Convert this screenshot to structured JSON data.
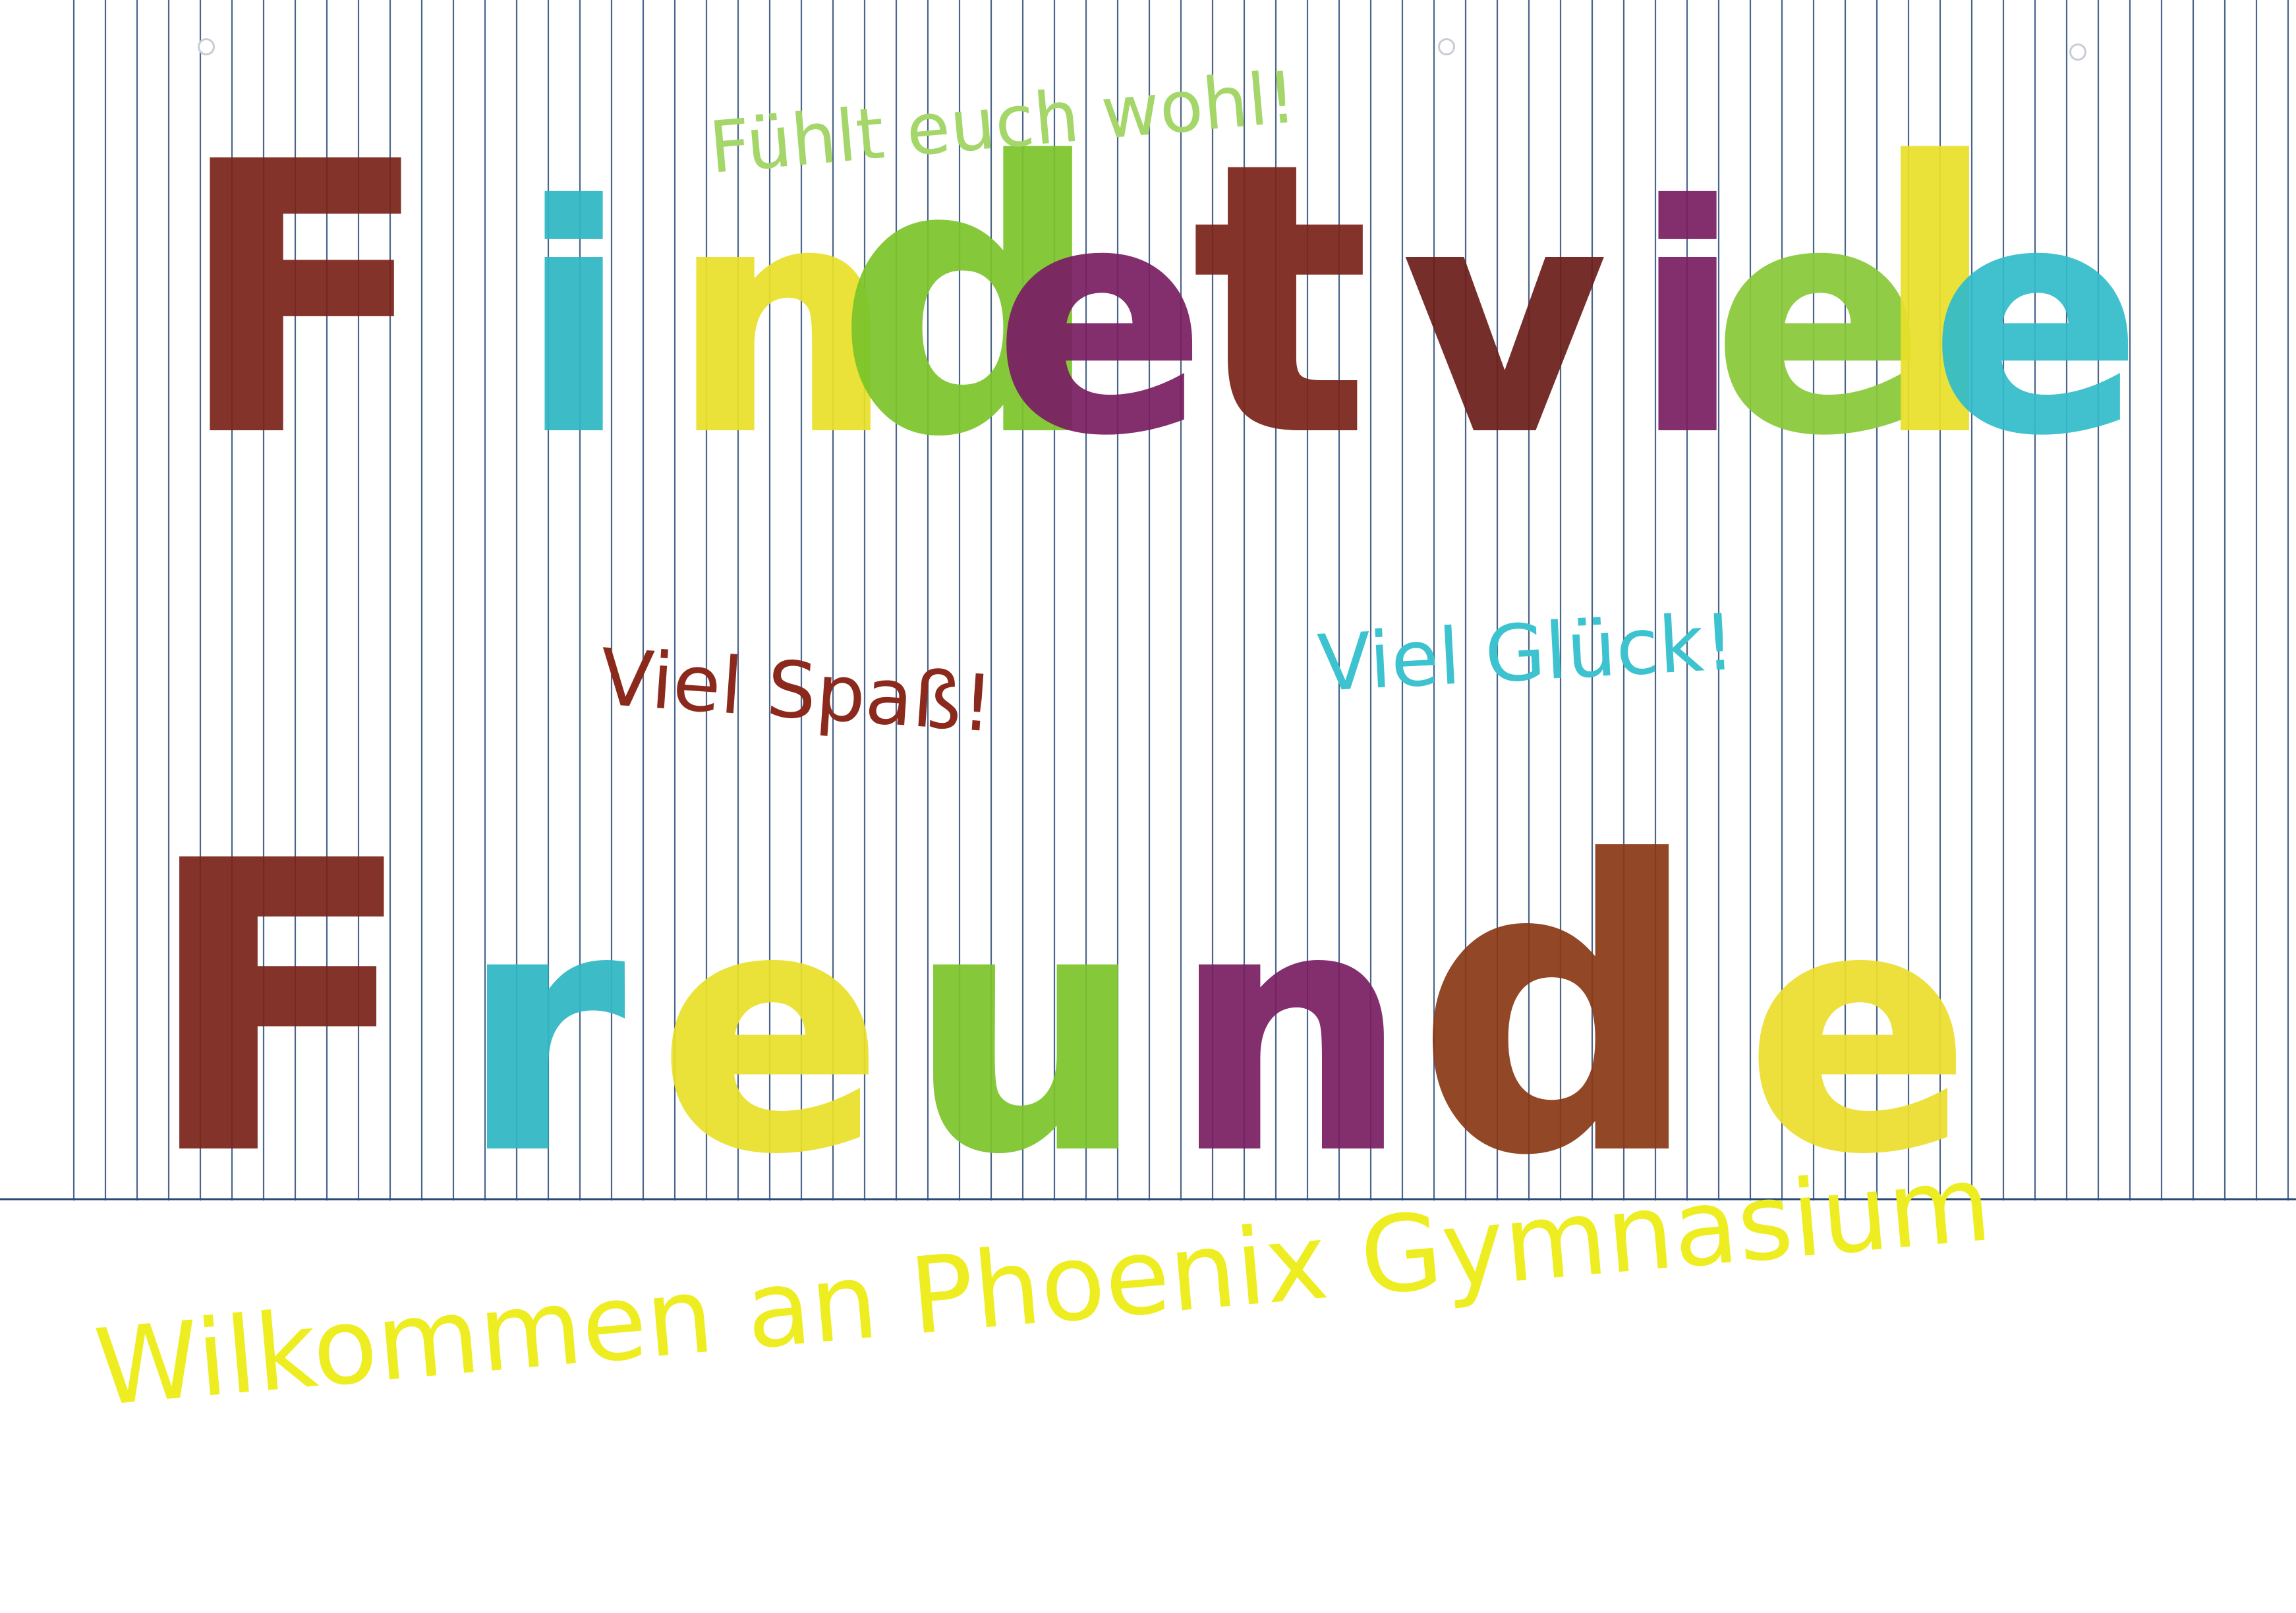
{
  "lines": [
    {
      "id": "findet-viele",
      "letters": [
        {
          "ch": "F",
          "color": "#7a2419"
        },
        {
          "ch": "i",
          "color": "#2fb8c4"
        },
        {
          "ch": "n",
          "color": "#e9e02a"
        },
        {
          "ch": "d",
          "color": "#7cc42c"
        },
        {
          "ch": "e",
          "color": "#7a1f63"
        },
        {
          "ch": "t",
          "color": "#7a2419"
        },
        {
          "ch": " ",
          "color": "#000000"
        },
        {
          "ch": "v",
          "color": "#6b1f1a"
        },
        {
          "ch": "i",
          "color": "#7a1f63"
        },
        {
          "ch": "e",
          "color": "#89c93a"
        },
        {
          "ch": "l",
          "color": "#e9e02a"
        },
        {
          "ch": "e",
          "color": "#33bccb"
        }
      ]
    },
    {
      "id": "freunde",
      "letters": [
        {
          "ch": "F",
          "color": "#7a2419"
        },
        {
          "ch": "r",
          "color": "#2fb8c4"
        },
        {
          "ch": "e",
          "color": "#e9e02a"
        },
        {
          "ch": "u",
          "color": "#7cc42c"
        },
        {
          "ch": "n",
          "color": "#7a1f63"
        },
        {
          "ch": "d",
          "color": "#8a3a16"
        },
        {
          "ch": "e",
          "color": "#ecde2e"
        }
      ]
    }
  ],
  "notes": {
    "fuehlt": {
      "text": "Fühlt euch wohl!",
      "color": "#a5d66a"
    },
    "spass": {
      "text": "Viel Spaß!",
      "color": "#8b2a1c"
    },
    "glueck": {
      "text": "Viel Glück!",
      "color": "#3cc3cf"
    },
    "willkommen": {
      "text": "Wilkommen an Phoenix Gymnasium",
      "color": "#eded22"
    }
  },
  "paper": {
    "line_color": "#2c4a78",
    "background": "#ffffff"
  }
}
